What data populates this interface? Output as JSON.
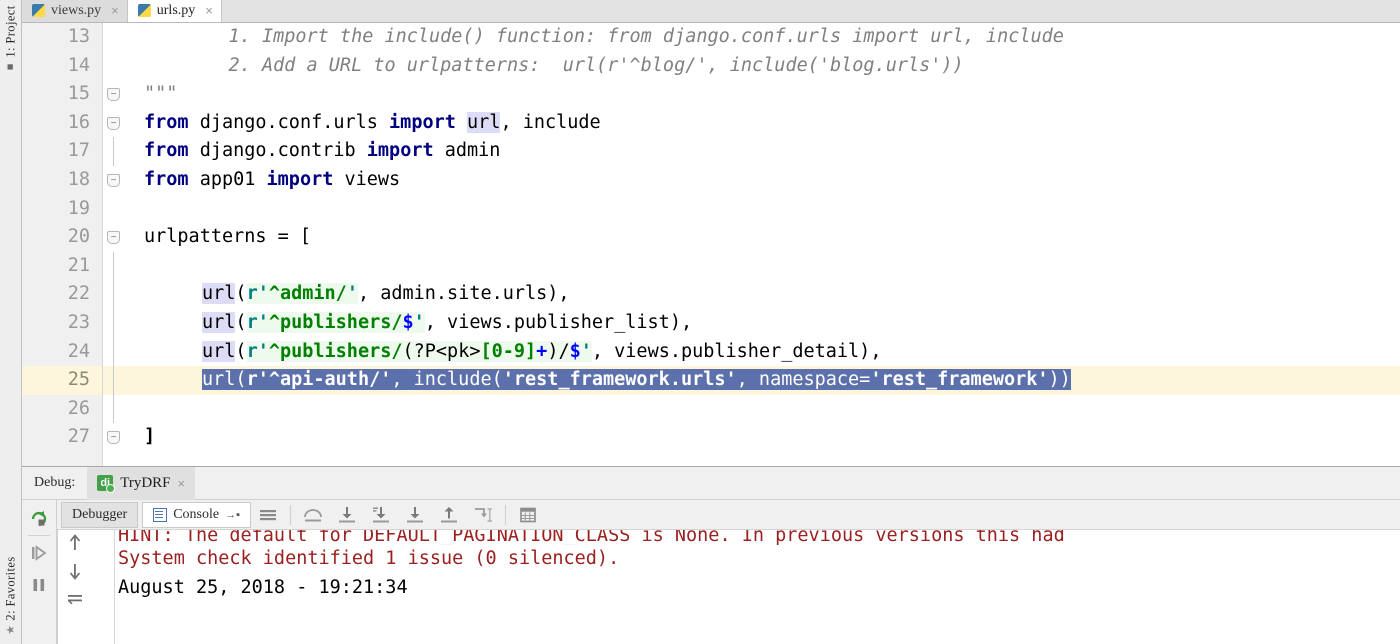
{
  "rail": {
    "top": {
      "label": "1: Project",
      "icon": "folder-icon"
    },
    "bottom": {
      "label": "2: Favorites",
      "icon": "star-icon"
    }
  },
  "editor": {
    "tabs": [
      {
        "label": "views.py",
        "active": false,
        "icon": "python-file-icon",
        "close": "×"
      },
      {
        "label": "urls.py",
        "active": true,
        "icon": "python-file-icon",
        "close": "×"
      }
    ],
    "lines": [
      {
        "num": "13",
        "fold": "",
        "selected": false,
        "current": false
      },
      {
        "num": "14",
        "fold": "",
        "selected": false,
        "current": false
      },
      {
        "num": "15",
        "fold": "end",
        "selected": false,
        "current": false
      },
      {
        "num": "16",
        "fold": "start",
        "selected": false,
        "current": false
      },
      {
        "num": "17",
        "fold": "",
        "selected": false,
        "current": false
      },
      {
        "num": "18",
        "fold": "end",
        "selected": false,
        "current": false
      },
      {
        "num": "19",
        "fold": "",
        "selected": false,
        "current": false
      },
      {
        "num": "20",
        "fold": "start",
        "selected": false,
        "current": false
      },
      {
        "num": "21",
        "fold": "",
        "selected": false,
        "current": false
      },
      {
        "num": "22",
        "fold": "",
        "selected": false,
        "current": false
      },
      {
        "num": "23",
        "fold": "",
        "selected": false,
        "current": false
      },
      {
        "num": "24",
        "fold": "",
        "selected": false,
        "current": false
      },
      {
        "num": "25",
        "fold": "",
        "selected": true,
        "current": true
      },
      {
        "num": "26",
        "fold": "",
        "selected": false,
        "current": false
      },
      {
        "num": "27",
        "fold": "end",
        "selected": false,
        "current": false
      }
    ],
    "code": {
      "l13": "    1. Import the include() function: from django.conf.urls import url, include",
      "l14": "    2. Add a URL to urlpatterns:  url(r'^blog/', include('blog.urls'))",
      "l15": "\"\"\"",
      "l16_kw1": "from",
      "l16_mod": " django.conf.urls ",
      "l16_kw2": "import",
      "l16_url": "url",
      "l16_rest": ", include",
      "l17_kw1": "from",
      "l17_mod": " django.contrib ",
      "l17_kw2": "import",
      "l17_rest": " admin",
      "l18_kw1": "from",
      "l18_mod": " app01 ",
      "l18_kw2": "import",
      "l18_rest": " views",
      "l20": "urlpatterns = [",
      "l22_fn": "url",
      "l22_open": "(",
      "l22_rprefix": "r'",
      "l22_rx": "^admin/",
      "l22_rquote": "'",
      "l22_tail": ", admin.site.urls),",
      "l23_fn": "url",
      "l23_open": "(",
      "l23_rprefix": "r'",
      "l23_rx": "^publishers/",
      "l23_dollar": "$",
      "l23_rquote": "'",
      "l23_tail": ", views.publisher_list),",
      "l24_fn": "url",
      "l24_open": "(",
      "l24_rprefix": "r'",
      "l24_rx1": "^publishers/",
      "l24_grp": "(?P<pk>",
      "l24_cls": "[0-9]",
      "l24_plus": "+",
      "l24_grpend": ")/",
      "l24_dollar": "$",
      "l24_rquote": "'",
      "l24_tail": ", views.publisher_detail),",
      "l25_full": "url(r'^api-auth/', include('rest_framework.urls', namespace='rest_framework'))",
      "l25_fn": "url(",
      "l25_s1": "r'^api-auth/'",
      "l25_mid": ", include(",
      "l25_s2": "'rest_framework.urls'",
      "l25_mid2": ", namespace=",
      "l25_s3": "'rest_framework'",
      "l25_end": "))",
      "l27": "]"
    }
  },
  "debug": {
    "label": "Debug:",
    "tab": {
      "label": "TryDRF",
      "icon": "django-icon",
      "badge": "dj",
      "close": "×"
    },
    "sidebar_buttons": [
      {
        "name": "rerun-button",
        "icon": "rerun-icon"
      },
      {
        "name": "resume-program-button",
        "icon": "resume-icon"
      },
      {
        "name": "pause-program-button",
        "icon": "pause-icon"
      }
    ],
    "tabs": [
      {
        "label": "Debugger",
        "active": false,
        "icon": "debugger-icon"
      },
      {
        "label": "Console",
        "active": true,
        "icon": "console-icon",
        "pin": "→▪"
      }
    ],
    "toolbar_buttons": [
      {
        "name": "show-options-menu-button",
        "icon": "hamburger-icon"
      },
      {
        "name": "step-over-button",
        "icon": "step-over-icon"
      },
      {
        "name": "step-into-button",
        "icon": "step-into-icon"
      },
      {
        "name": "force-step-into-button",
        "icon": "force-step-into-icon"
      },
      {
        "name": "smart-step-into-button",
        "icon": "smart-step-into-icon"
      },
      {
        "name": "step-out-button",
        "icon": "step-out-icon"
      },
      {
        "name": "run-to-cursor-button",
        "icon": "run-to-cursor-icon"
      },
      {
        "name": "evaluate-expression-button",
        "icon": "evaluate-icon"
      }
    ],
    "stepper_buttons": [
      {
        "name": "scroll-up-button",
        "icon": "arrow-up-icon"
      },
      {
        "name": "scroll-down-button",
        "icon": "arrow-down-icon"
      },
      {
        "name": "soft-wrap-button",
        "icon": "wrap-lines-icon"
      }
    ],
    "console": {
      "clipped_line": "HINT: The default for DEFAULT_PAGINATION_CLASS is None. In previous versions this had",
      "lines": [
        {
          "text": "System check identified 1 issue (0 silenced).",
          "style": "err"
        },
        {
          "text": "August 25, 2018 - 19:21:34",
          "style": "normal"
        }
      ]
    }
  },
  "colors": {
    "selection": "#5c71ab",
    "caret_line": "#fdf6dd",
    "keyword": "#000080",
    "string": "#008000",
    "comment": "#808080",
    "error_text": "#9b2020",
    "identifier_highlight": "#dcdcf7",
    "string_highlight": "#eefaee",
    "chrome": "#f0f0f0"
  }
}
